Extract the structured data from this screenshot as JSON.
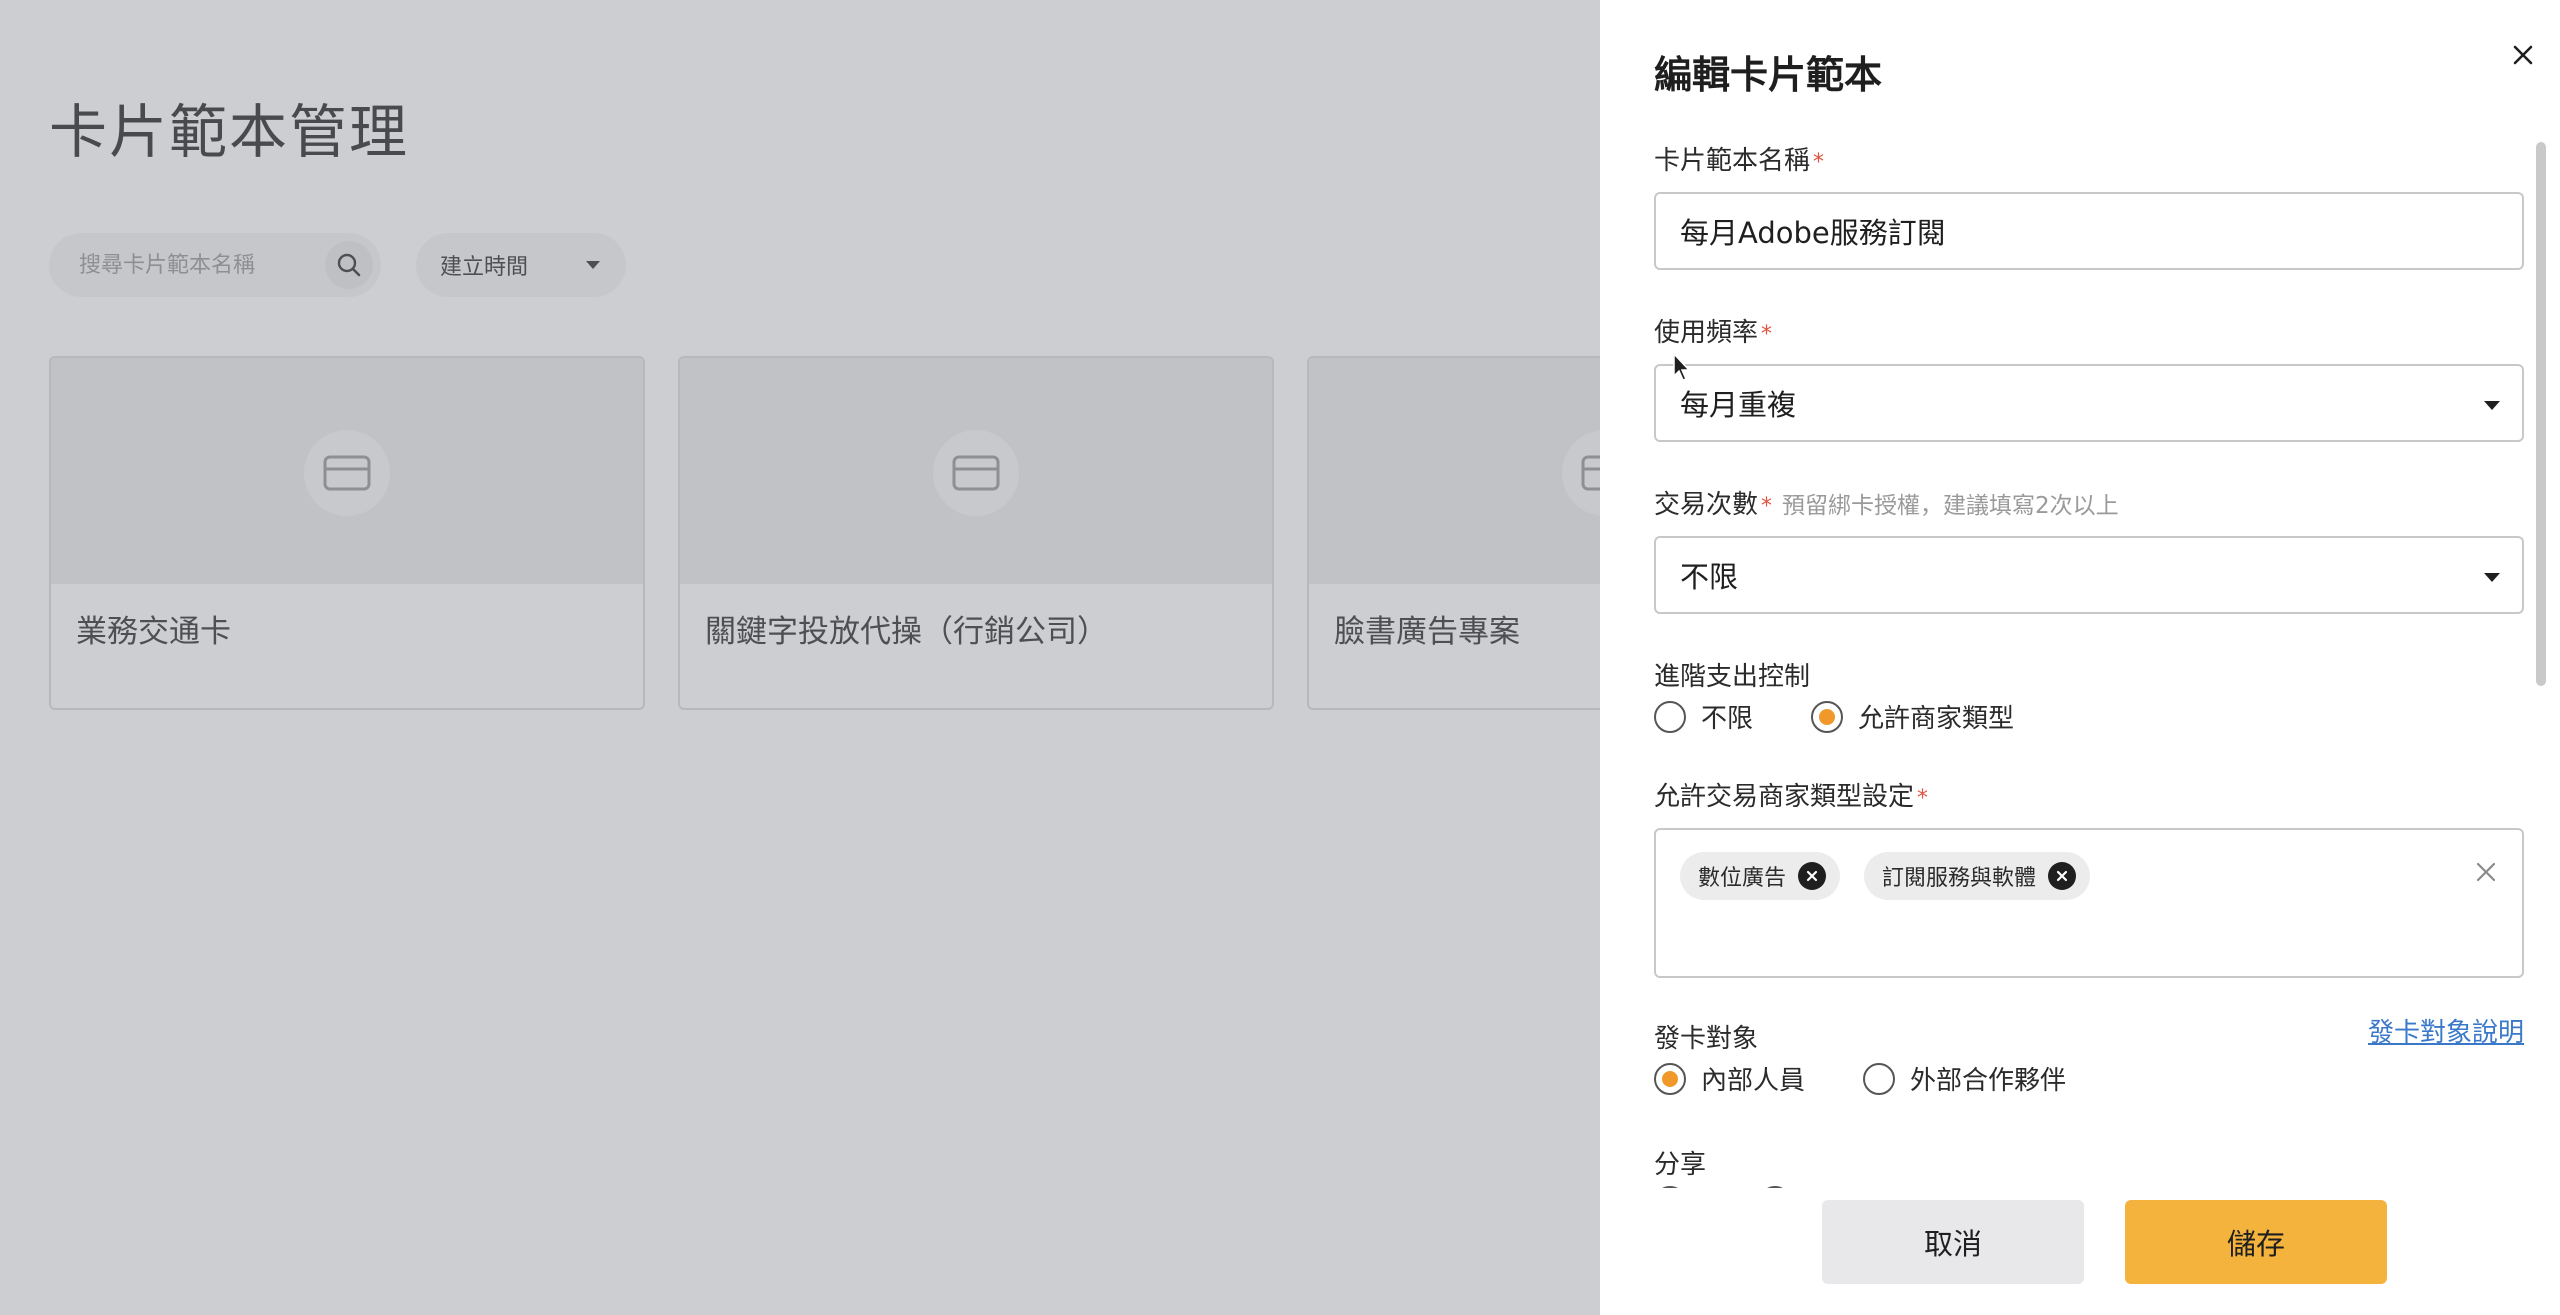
{
  "page": {
    "title": "卡片範本管理",
    "search_placeholder": "搜尋卡片範本名稱",
    "sort_label": "建立時間"
  },
  "cards": [
    {
      "name": "業務交通卡"
    },
    {
      "name": "關鍵字投放代操（行銷公司）"
    },
    {
      "name": "臉書廣告專案"
    }
  ],
  "drawer": {
    "title": "編輯卡片範本",
    "name_field": {
      "label": "卡片範本名稱",
      "required": "*",
      "value": "每月Adobe服務訂閱"
    },
    "frequency_field": {
      "label": "使用頻率",
      "required": "*",
      "value": "每月重複"
    },
    "transactions_field": {
      "label": "交易次數",
      "required": "*",
      "hint": "預留綁卡授權，建議填寫2次以上",
      "value": "不限"
    },
    "advanced_control": {
      "label": "進階支出控制",
      "options": [
        "不限",
        "允許商家類型"
      ],
      "selected": 1
    },
    "merchant_types": {
      "label": "允許交易商家類型設定",
      "required": "*",
      "tags": [
        "數位廣告",
        "訂閱服務與軟體"
      ]
    },
    "issue_target": {
      "label": "發卡對象",
      "link": "發卡對象說明",
      "options": [
        "內部人員",
        "外部合作夥伴"
      ],
      "selected": 0
    },
    "share": {
      "label": "分享"
    },
    "cancel_label": "取消",
    "save_label": "儲存"
  },
  "colors": {
    "accent": "#f0992a",
    "save_button": "#f3b33d",
    "link": "#3a78c9",
    "required": "#e0533f"
  }
}
